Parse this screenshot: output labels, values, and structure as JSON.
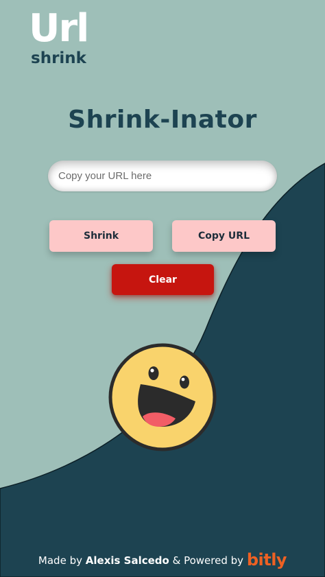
{
  "logo": {
    "title": "Url",
    "subtitle": "shrink"
  },
  "main": {
    "heading": "Shrink-Inator",
    "url_input": {
      "value": "",
      "placeholder": "Copy your URL here"
    },
    "buttons": {
      "shrink_label": "Shrink",
      "copy_label": "Copy URL",
      "clear_label": "Clear"
    },
    "mascot_icon": "laughing-smiley-icon"
  },
  "footer": {
    "made_by_prefix": "Made by",
    "author": "Alexis Salcedo",
    "powered_by": "& Powered by",
    "brand": "bitly"
  },
  "colors": {
    "background": "#9ebfb8",
    "wave": "#1d4351",
    "heading": "#1d4351",
    "pink_button": "#fdc8c8",
    "clear_button": "#c6150f",
    "smiley_face": "#f9d36c",
    "bitly_orange": "#ee6123"
  }
}
